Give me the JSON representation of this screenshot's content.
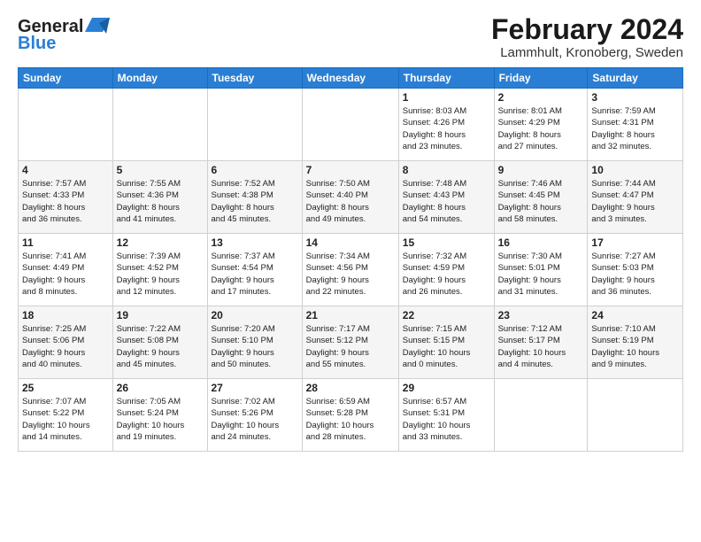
{
  "header": {
    "logo_line1": "General",
    "logo_line2": "Blue",
    "title": "February 2024",
    "subtitle": "Lammhult, Kronoberg, Sweden"
  },
  "weekdays": [
    "Sunday",
    "Monday",
    "Tuesday",
    "Wednesday",
    "Thursday",
    "Friday",
    "Saturday"
  ],
  "weeks": [
    [
      {
        "day": "",
        "info": ""
      },
      {
        "day": "",
        "info": ""
      },
      {
        "day": "",
        "info": ""
      },
      {
        "day": "",
        "info": ""
      },
      {
        "day": "1",
        "info": "Sunrise: 8:03 AM\nSunset: 4:26 PM\nDaylight: 8 hours\nand 23 minutes."
      },
      {
        "day": "2",
        "info": "Sunrise: 8:01 AM\nSunset: 4:29 PM\nDaylight: 8 hours\nand 27 minutes."
      },
      {
        "day": "3",
        "info": "Sunrise: 7:59 AM\nSunset: 4:31 PM\nDaylight: 8 hours\nand 32 minutes."
      }
    ],
    [
      {
        "day": "4",
        "info": "Sunrise: 7:57 AM\nSunset: 4:33 PM\nDaylight: 8 hours\nand 36 minutes."
      },
      {
        "day": "5",
        "info": "Sunrise: 7:55 AM\nSunset: 4:36 PM\nDaylight: 8 hours\nand 41 minutes."
      },
      {
        "day": "6",
        "info": "Sunrise: 7:52 AM\nSunset: 4:38 PM\nDaylight: 8 hours\nand 45 minutes."
      },
      {
        "day": "7",
        "info": "Sunrise: 7:50 AM\nSunset: 4:40 PM\nDaylight: 8 hours\nand 49 minutes."
      },
      {
        "day": "8",
        "info": "Sunrise: 7:48 AM\nSunset: 4:43 PM\nDaylight: 8 hours\nand 54 minutes."
      },
      {
        "day": "9",
        "info": "Sunrise: 7:46 AM\nSunset: 4:45 PM\nDaylight: 8 hours\nand 58 minutes."
      },
      {
        "day": "10",
        "info": "Sunrise: 7:44 AM\nSunset: 4:47 PM\nDaylight: 9 hours\nand 3 minutes."
      }
    ],
    [
      {
        "day": "11",
        "info": "Sunrise: 7:41 AM\nSunset: 4:49 PM\nDaylight: 9 hours\nand 8 minutes."
      },
      {
        "day": "12",
        "info": "Sunrise: 7:39 AM\nSunset: 4:52 PM\nDaylight: 9 hours\nand 12 minutes."
      },
      {
        "day": "13",
        "info": "Sunrise: 7:37 AM\nSunset: 4:54 PM\nDaylight: 9 hours\nand 17 minutes."
      },
      {
        "day": "14",
        "info": "Sunrise: 7:34 AM\nSunset: 4:56 PM\nDaylight: 9 hours\nand 22 minutes."
      },
      {
        "day": "15",
        "info": "Sunrise: 7:32 AM\nSunset: 4:59 PM\nDaylight: 9 hours\nand 26 minutes."
      },
      {
        "day": "16",
        "info": "Sunrise: 7:30 AM\nSunset: 5:01 PM\nDaylight: 9 hours\nand 31 minutes."
      },
      {
        "day": "17",
        "info": "Sunrise: 7:27 AM\nSunset: 5:03 PM\nDaylight: 9 hours\nand 36 minutes."
      }
    ],
    [
      {
        "day": "18",
        "info": "Sunrise: 7:25 AM\nSunset: 5:06 PM\nDaylight: 9 hours\nand 40 minutes."
      },
      {
        "day": "19",
        "info": "Sunrise: 7:22 AM\nSunset: 5:08 PM\nDaylight: 9 hours\nand 45 minutes."
      },
      {
        "day": "20",
        "info": "Sunrise: 7:20 AM\nSunset: 5:10 PM\nDaylight: 9 hours\nand 50 minutes."
      },
      {
        "day": "21",
        "info": "Sunrise: 7:17 AM\nSunset: 5:12 PM\nDaylight: 9 hours\nand 55 minutes."
      },
      {
        "day": "22",
        "info": "Sunrise: 7:15 AM\nSunset: 5:15 PM\nDaylight: 10 hours\nand 0 minutes."
      },
      {
        "day": "23",
        "info": "Sunrise: 7:12 AM\nSunset: 5:17 PM\nDaylight: 10 hours\nand 4 minutes."
      },
      {
        "day": "24",
        "info": "Sunrise: 7:10 AM\nSunset: 5:19 PM\nDaylight: 10 hours\nand 9 minutes."
      }
    ],
    [
      {
        "day": "25",
        "info": "Sunrise: 7:07 AM\nSunset: 5:22 PM\nDaylight: 10 hours\nand 14 minutes."
      },
      {
        "day": "26",
        "info": "Sunrise: 7:05 AM\nSunset: 5:24 PM\nDaylight: 10 hours\nand 19 minutes."
      },
      {
        "day": "27",
        "info": "Sunrise: 7:02 AM\nSunset: 5:26 PM\nDaylight: 10 hours\nand 24 minutes."
      },
      {
        "day": "28",
        "info": "Sunrise: 6:59 AM\nSunset: 5:28 PM\nDaylight: 10 hours\nand 28 minutes."
      },
      {
        "day": "29",
        "info": "Sunrise: 6:57 AM\nSunset: 5:31 PM\nDaylight: 10 hours\nand 33 minutes."
      },
      {
        "day": "",
        "info": ""
      },
      {
        "day": "",
        "info": ""
      }
    ]
  ]
}
